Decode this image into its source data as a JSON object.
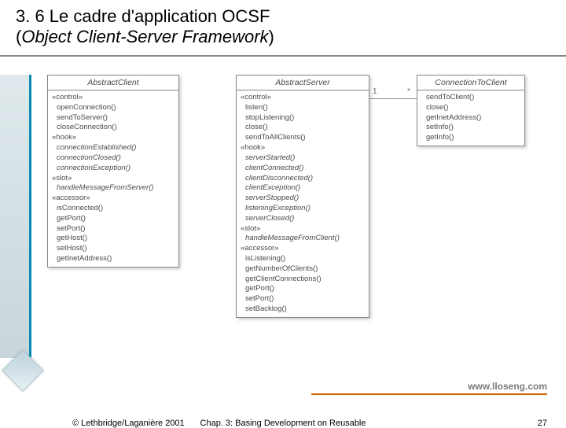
{
  "title": {
    "line1": "3. 6  Le cadre d'application OCSF",
    "line2_open": "(",
    "line2_italic": "Object Client-Server Framework",
    "line2_close": ")"
  },
  "classes": {
    "abstractClient": {
      "name": "AbstractClient",
      "s1": "«control»",
      "m1a": "openConnection()",
      "m1b": "sendToServer()",
      "m1c": "closeConnection()",
      "s2": "«hook»",
      "m2a": "connectionEstablished()",
      "m2b": "connectionClosed()",
      "m2c": "connectionException()",
      "s3": "«slot»",
      "m3a": "handleMessageFromServer()",
      "s4": "«accessor»",
      "m4a": "isConnected()",
      "m4b": "getPort()",
      "m4c": "setPort()",
      "m4d": "getHost()",
      "m4e": "setHost()",
      "m4f": "getInetAddress()"
    },
    "abstractServer": {
      "name": "AbstractServer",
      "s1": "«control»",
      "m1a": "listen()",
      "m1b": "stopListening()",
      "m1c": "close()",
      "m1d": "sendToAllClients()",
      "s2": "«hook»",
      "m2a": "serverStarted()",
      "m2b": "clientConnected()",
      "m2c": "clientDisconnected()",
      "m2d": "clientException()",
      "m2e": "serverStopped()",
      "m2f": "listeningException()",
      "m2g": "serverClosed()",
      "s3": "«slot»",
      "m3a": "handleMessageFromClient()",
      "s4": "«accessor»",
      "m4a": "isListening()",
      "m4b": "getNumberOfClients()",
      "m4c": "getClientConnections()",
      "m4d": "getPort()",
      "m4e": "setPort()",
      "m4f": "setBacklog()"
    },
    "connectionToClient": {
      "name": "ConnectionToClient",
      "m1": "sendToClient()",
      "m2": "close()",
      "m3": "getInetAddress()",
      "m4": "setInfo()",
      "m5": "getInfo()"
    }
  },
  "mult": {
    "one": "1",
    "many": "*"
  },
  "url": "www.lloseng.com",
  "footer": {
    "left": "© Lethbridge/Laganière 2001",
    "center": "Chap. 3: Basing Development on Reusable",
    "right": "27"
  }
}
